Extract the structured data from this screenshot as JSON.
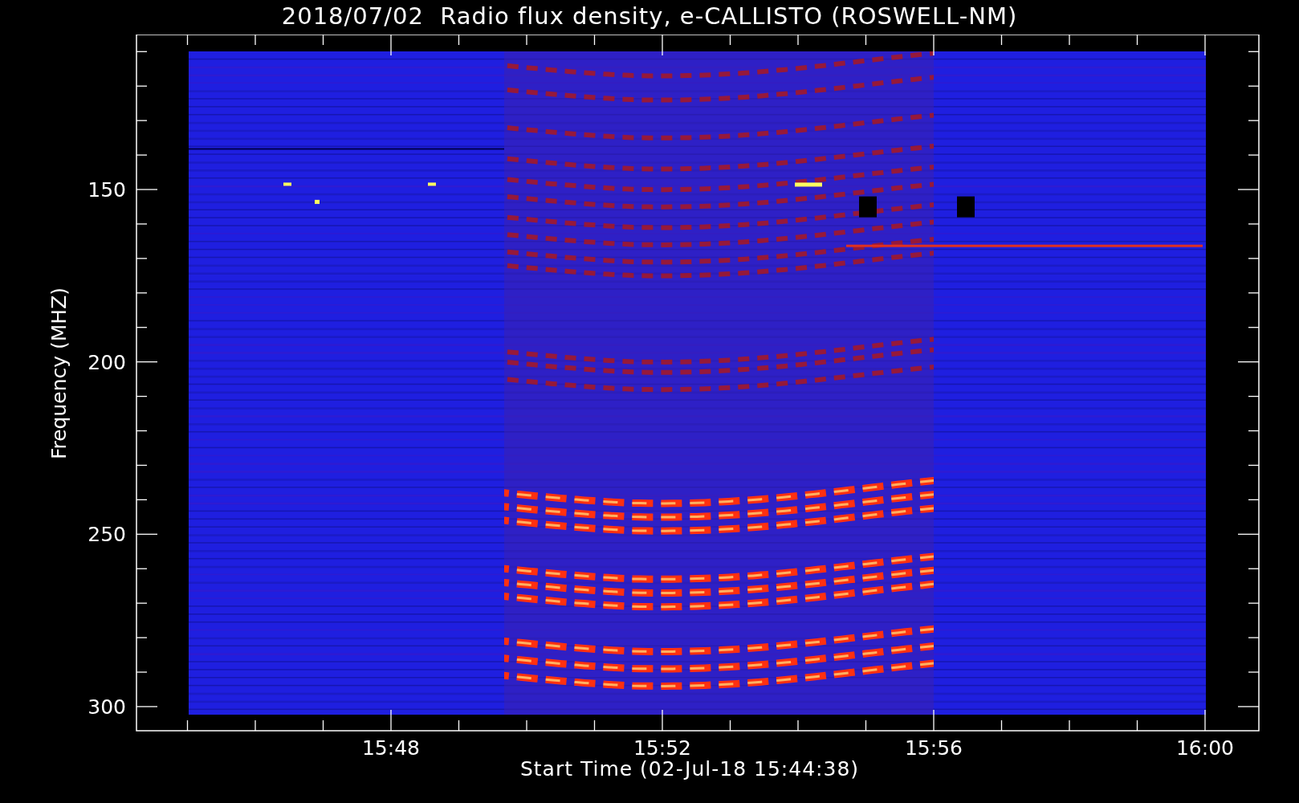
{
  "title": "2018/07/02  Radio flux density, e-CALLISTO (ROSWELL-NM)",
  "y_axis": {
    "label": "Frequency (MHZ)",
    "ticks": [
      "150",
      "200",
      "250",
      "300"
    ]
  },
  "x_axis": {
    "label": "Start Time (02-Jul-18 15:44:38)",
    "ticks": [
      "15:48",
      "15:52",
      "15:56",
      "16:00"
    ]
  }
}
